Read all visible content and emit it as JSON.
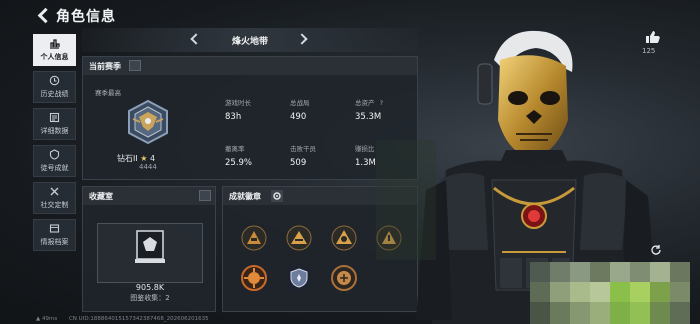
{
  "header": {
    "title": "角色信息",
    "like_count": "125"
  },
  "sidebar": {
    "items": [
      {
        "label": "个人信息",
        "icon": "bar-chart-icon",
        "active": true
      },
      {
        "label": "历史战绩",
        "icon": "history-icon",
        "active": false
      },
      {
        "label": "详细数据",
        "icon": "data-icon",
        "active": false
      },
      {
        "label": "徒号成就",
        "icon": "medal-icon",
        "active": false
      },
      {
        "label": "社交定制",
        "icon": "tools-icon",
        "active": false
      },
      {
        "label": "情报档案",
        "icon": "archive-icon",
        "active": false
      }
    ]
  },
  "season": {
    "mode_title": "烽火地带"
  },
  "current_season": {
    "label": "当前赛季",
    "subtitle": "赛季最高",
    "rank_name": "钻石II",
    "rank_stars": "4",
    "rank_points": "4444",
    "stats": [
      {
        "label": "游戏时长",
        "value": "83h"
      },
      {
        "label": "总战局",
        "value": "490"
      },
      {
        "label": "总资产",
        "value": "35.3M",
        "info": "?"
      },
      {
        "label": "撤离率",
        "value": "25.9%"
      },
      {
        "label": "击败干员",
        "value": "509"
      },
      {
        "label": "赚损比",
        "value": "1.3M"
      }
    ]
  },
  "vault": {
    "label": "收藏室",
    "value": "905.8K",
    "collection": "图鉴收集：2"
  },
  "achievements": {
    "label": "成就徽章",
    "medals": [
      "rank-medal-1",
      "rank-medal-2",
      "rank-medal-3",
      "rank-medal-4",
      "orange-medal",
      "shield-medal",
      "bronze-medal"
    ]
  },
  "footer": {
    "ping": "49ms",
    "uid": "CN UID:188864015157342387468_202606201635"
  },
  "colors": {
    "accent": "#e9c46a",
    "active_tab": "#eceef1",
    "panel": "#20252b"
  }
}
